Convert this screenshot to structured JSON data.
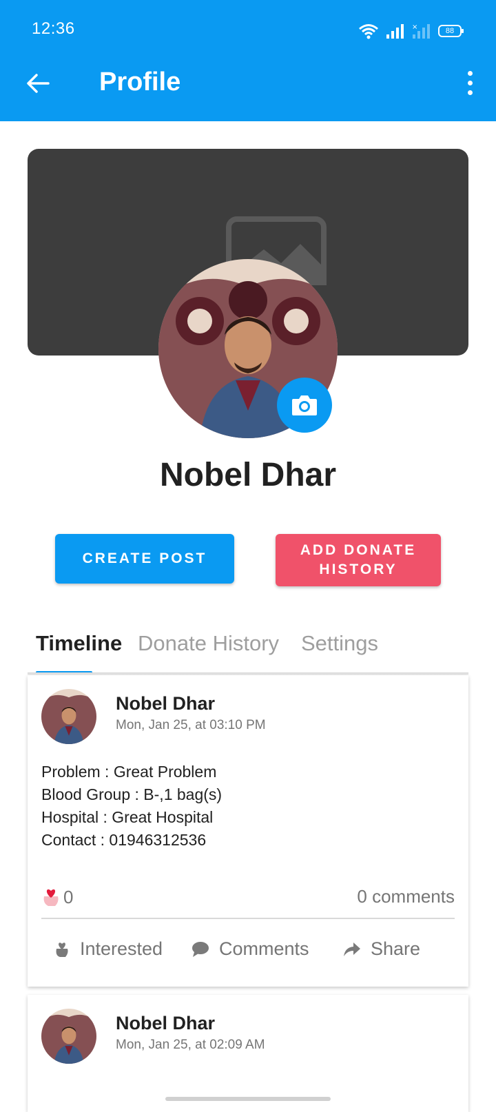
{
  "status_bar": {
    "time": "12:36",
    "battery": "88"
  },
  "app_bar": {
    "title": "Profile"
  },
  "profile": {
    "name": "Nobel Dhar"
  },
  "buttons": {
    "create_post": "CREATE POST",
    "add_donate_history": "ADD DONATE HISTORY"
  },
  "tabs": [
    {
      "label": "Timeline",
      "active": true
    },
    {
      "label": "Donate History",
      "active": false
    },
    {
      "label": "Settings",
      "active": false
    }
  ],
  "posts": [
    {
      "author": "Nobel Dhar",
      "time": "Mon, Jan 25, at 03:10 PM",
      "lines": [
        "Problem : Great Problem",
        "Blood Group : B-,1 bag(s)",
        "Hospital : Great Hospital",
        "Contact : 01946312536"
      ],
      "likes": "0",
      "comments": "0 comments",
      "actions": {
        "interested": "Interested",
        "comments": "Comments",
        "share": "Share"
      }
    },
    {
      "author": "Nobel Dhar",
      "time": "Mon, Jan 25, at 02:09 AM"
    }
  ],
  "colors": {
    "primary": "#0a9af2",
    "accent": "#f0526a",
    "cover": "#3d3d3d"
  }
}
